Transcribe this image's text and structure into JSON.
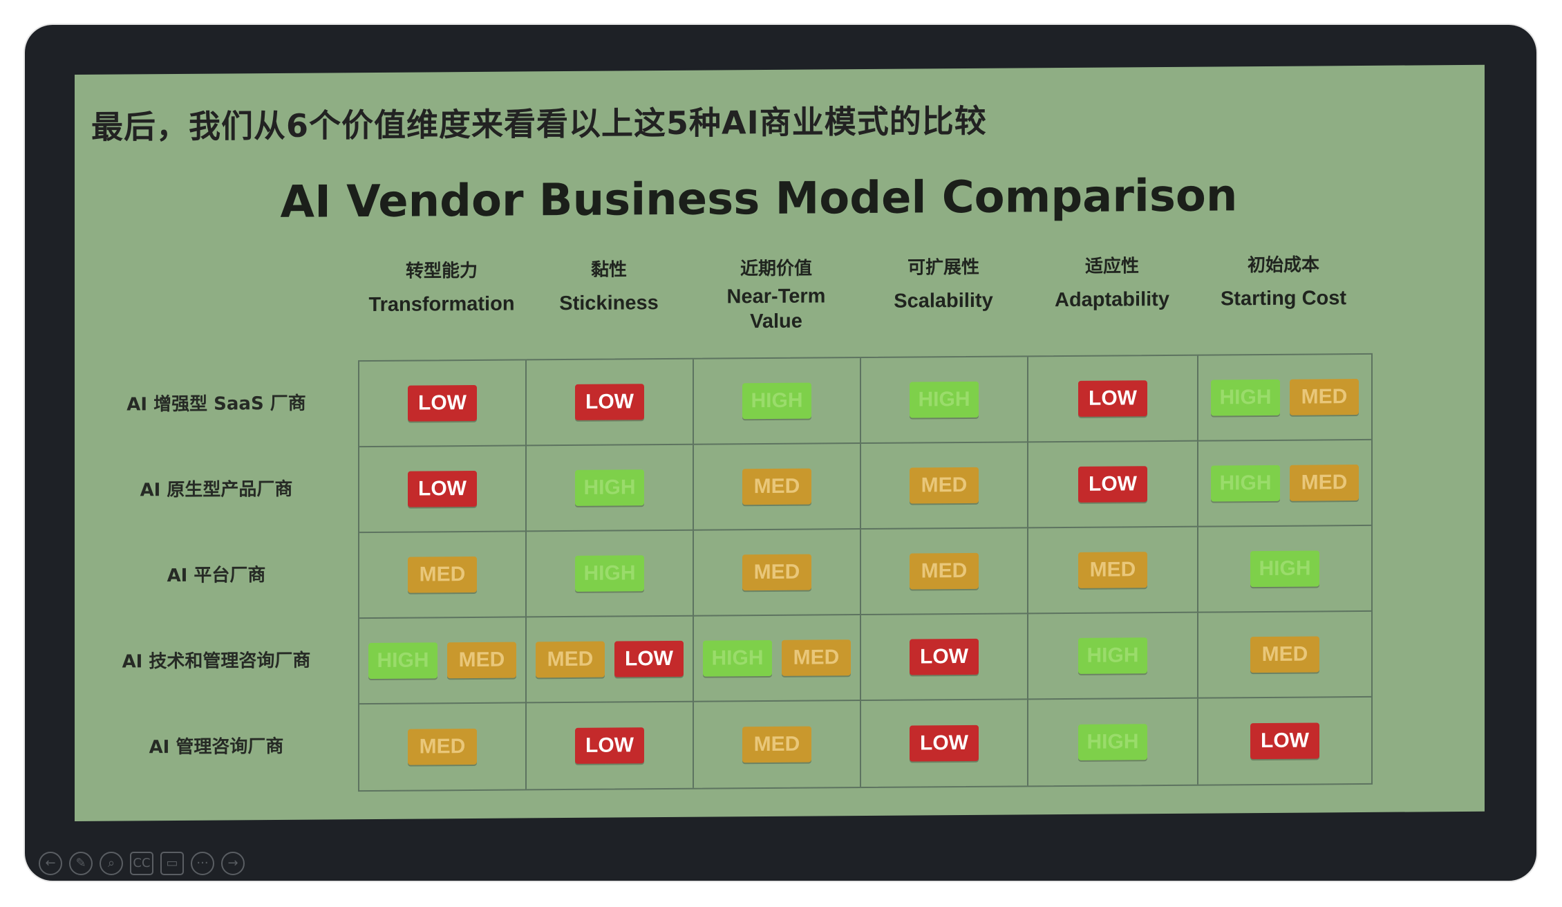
{
  "slide": {
    "title": "最后，我们从6个价值维度来看看以上这5种AI商业模式的比较",
    "chart_title": "AI Vendor Business Model Comparison"
  },
  "columns": [
    {
      "zh": "转型能力",
      "en": "Transformation"
    },
    {
      "zh": "黏性",
      "en": "Stickiness"
    },
    {
      "zh": "近期价值",
      "en": "Near-Term Value"
    },
    {
      "zh": "可扩展性",
      "en": "Scalability"
    },
    {
      "zh": "适应性",
      "en": "Adaptability"
    },
    {
      "zh": "初始成本",
      "en": "Starting Cost"
    }
  ],
  "rows": [
    {
      "label": "AI 增强型 SaaS 厂商",
      "cells": [
        [
          "LOW"
        ],
        [
          "LOW"
        ],
        [
          "HIGH"
        ],
        [
          "HIGH"
        ],
        [
          "LOW"
        ],
        [
          "HIGH",
          "MED"
        ]
      ]
    },
    {
      "label": "AI 原生型产品厂商",
      "cells": [
        [
          "LOW"
        ],
        [
          "HIGH"
        ],
        [
          "MED"
        ],
        [
          "MED"
        ],
        [
          "LOW"
        ],
        [
          "HIGH",
          "MED"
        ]
      ]
    },
    {
      "label": "AI 平台厂商",
      "cells": [
        [
          "MED"
        ],
        [
          "HIGH"
        ],
        [
          "MED"
        ],
        [
          "MED"
        ],
        [
          "MED"
        ],
        [
          "HIGH"
        ]
      ]
    },
    {
      "label": "AI 技术和管理咨询厂商",
      "cells": [
        [
          "HIGH",
          "MED"
        ],
        [
          "MED",
          "LOW"
        ],
        [
          "HIGH",
          "MED"
        ],
        [
          "LOW"
        ],
        [
          "HIGH"
        ],
        [
          "MED"
        ]
      ]
    },
    {
      "label": "AI 管理咨询厂商",
      "cells": [
        [
          "MED"
        ],
        [
          "LOW"
        ],
        [
          "MED"
        ],
        [
          "LOW"
        ],
        [
          "HIGH"
        ],
        [
          "LOW"
        ]
      ]
    }
  ],
  "toolbar": [
    {
      "icon": "previous-icon",
      "glyph": "←"
    },
    {
      "icon": "pen-icon",
      "glyph": "✎"
    },
    {
      "icon": "zoom-icon",
      "glyph": "⌕"
    },
    {
      "icon": "captions-icon",
      "glyph": "CC"
    },
    {
      "icon": "camera-icon",
      "glyph": "▭"
    },
    {
      "icon": "more-icon",
      "glyph": "···"
    },
    {
      "icon": "next-icon",
      "glyph": "→"
    }
  ]
}
